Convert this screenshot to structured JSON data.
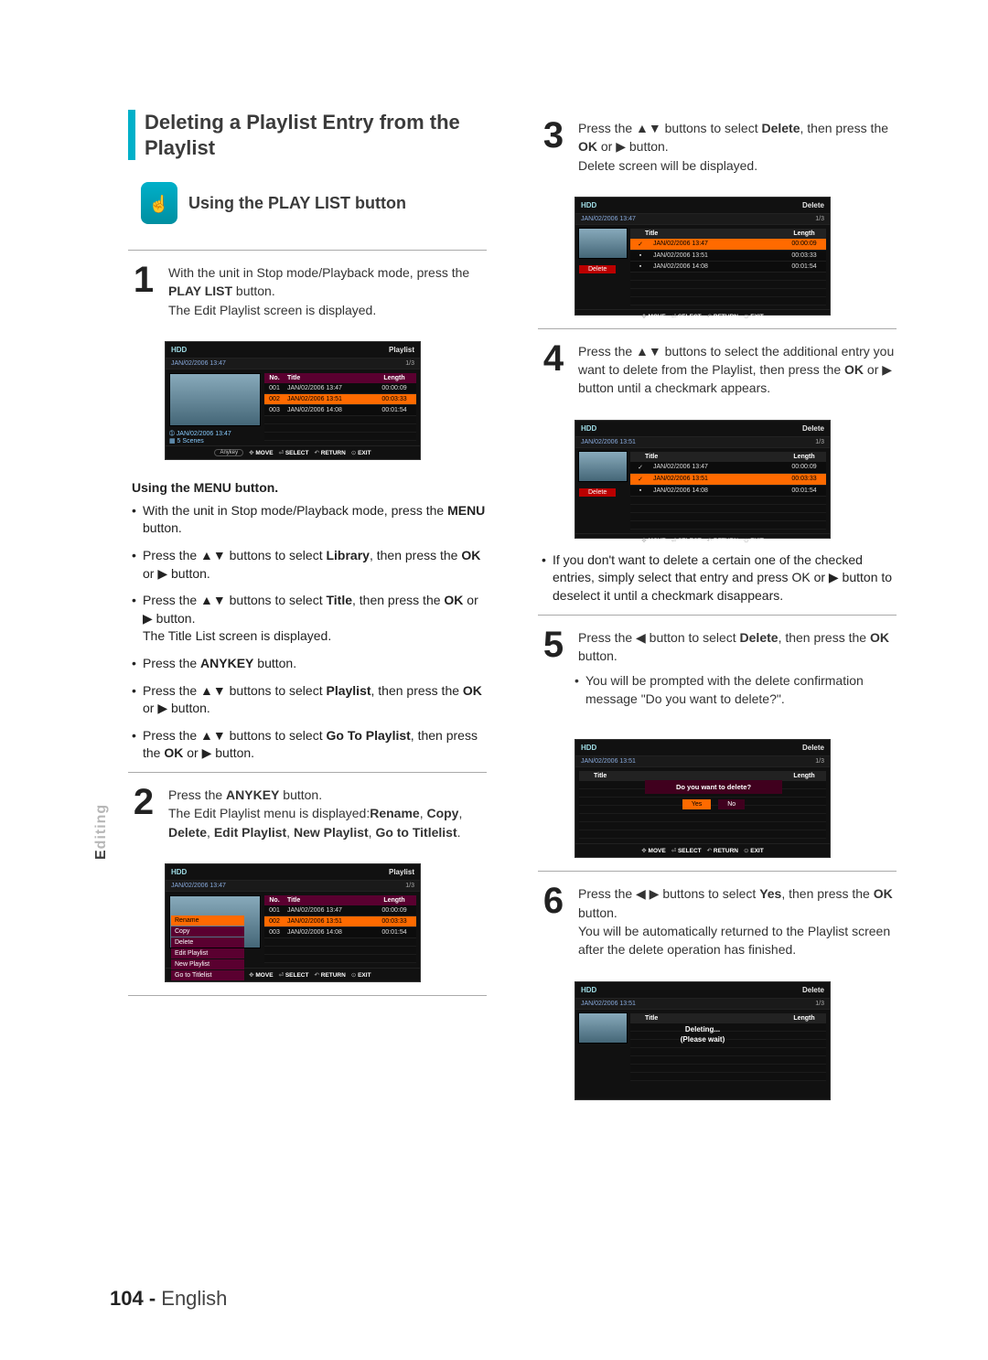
{
  "section_title": "Deleting a Playlist Entry from the Playlist",
  "play_title": "Using the PLAY LIST button",
  "step1": {
    "num": "1",
    "text_a": "With the unit in Stop mode/Playback mode, press the ",
    "bold_a": "PLAY LIST",
    "text_b": " button.",
    "line2": "The Edit Playlist screen is displayed."
  },
  "menu_subhead": "Using the MENU button.",
  "menu_bullets": [
    {
      "a": "With the unit in Stop mode/Playback mode, press the ",
      "b": "MENU",
      "c": " button."
    },
    {
      "a": "Press the ▲▼ buttons to select ",
      "b": "Library",
      "c": ", then press the ",
      "d": "OK",
      "e": " or ▶ button."
    },
    {
      "a": "Press the ▲▼ buttons to select ",
      "b": "Title",
      "c": ", then press the ",
      "d": "OK",
      "e": " or ▶ button.",
      "f": "The Title List screen is displayed."
    },
    {
      "a": "Press the ",
      "b": "ANYKEY",
      "c": " button."
    },
    {
      "a": "Press the ▲▼ buttons to select ",
      "b": "Playlist",
      "c": ", then press the ",
      "d": "OK",
      "e": " or ▶ button."
    },
    {
      "a": "Press the ▲▼ buttons to select ",
      "b": "Go To Playlist",
      "c": ", then press the ",
      "d": "OK",
      "e": " or ▶ button."
    }
  ],
  "step2": {
    "num": "2",
    "a": "Press the ",
    "b": "ANYKEY",
    "c": " button.",
    "line2a": "The Edit Playlist menu is displayed:",
    "line2b": "Rename",
    "line2c": ", ",
    "line2d": "Copy",
    "line2e": ", ",
    "line2f": "Delete",
    "line2g": ", ",
    "line2h": "Edit Playlist",
    "line2i": ", ",
    "line2j": "New Playlist",
    "line2k": ", ",
    "line2l": "Go to Titlelist",
    "line2m": "."
  },
  "step3": {
    "num": "3",
    "a": "Press the ▲▼ buttons to select ",
    "b": "Delete",
    "c": ", then press the ",
    "d": "OK",
    "e": " or ▶ button.",
    "line2": "Delete screen will be displayed."
  },
  "step4": {
    "num": "4",
    "a": "Press the ▲▼ buttons to select the additional entry you want to delete from the Playlist, then press the ",
    "b": "OK",
    "c": " or ▶ button until a checkmark appears.",
    "bullet": "If you don't want to delete a certain one of the checked entries, simply select that entry and press OK or ▶ button to deselect it until a checkmark disappears."
  },
  "step5": {
    "num": "5",
    "a": "Press the ◀ button to select ",
    "b": "Delete",
    "c": ", then press the ",
    "d": "OK",
    "e": " button.",
    "bullet": "You will be prompted with the delete confirmation message \"Do you want to delete?\"."
  },
  "step6": {
    "num": "6",
    "a": "Press the ◀ ▶ buttons to select ",
    "b": "Yes",
    "c": ", then press the ",
    "d": "OK",
    "e": " button.",
    "line2": "You will be automatically returned to the Playlist screen after the delete operation has finished."
  },
  "side_tab_grey": "E",
  "side_tab_rest": "diting",
  "footer_page": "104 - ",
  "footer_lang": "English",
  "scr": {
    "hdd": "HDD",
    "playlist": "Playlist",
    "delete": "Delete",
    "f13": "1/3",
    "date1": "JAN/02/2006 13:47",
    "date2": "JAN/02/2006 13:51",
    "colNo": "No.",
    "colTitle": "Title",
    "colLen": "Length",
    "rows": [
      {
        "n": "001",
        "t": "JAN/02/2006 13:47",
        "l": "00:00:09"
      },
      {
        "n": "002",
        "t": "JAN/02/2006 13:51",
        "l": "00:03:33"
      },
      {
        "n": "003",
        "t": "JAN/02/2006 14:08",
        "l": "00:01:54"
      }
    ],
    "info_date": "➀ JAN/02/2006 13:47",
    "info_scenes": "▦ 5 Scenes",
    "menu_items": [
      "Rename",
      "Copy",
      "Delete",
      "Edit Playlist",
      "New Playlist",
      "Go to Titlelist"
    ],
    "foot_move": "MOVE",
    "foot_select": "SELECT",
    "foot_return": "RETURN",
    "foot_exit": "EXIT",
    "anykey": "Anykey",
    "move_sym": "✥",
    "sel_sym": "⏎",
    "ret_sym": "↶",
    "exit_sym": "⊙",
    "confirm": "Do you want to delete?",
    "yes": "Yes",
    "no": "No",
    "deleting": "Deleting...",
    "wait": "(Please wait)",
    "del_btn": "Delete"
  }
}
